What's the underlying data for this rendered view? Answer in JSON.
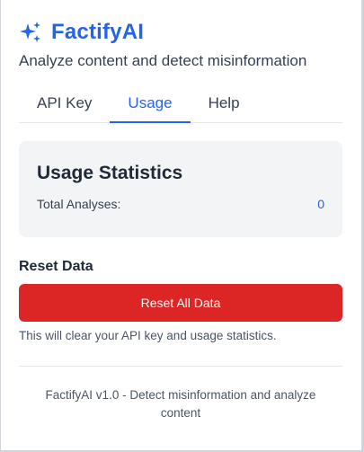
{
  "brand": {
    "title": "FactifyAI",
    "subtitle": "Analyze content and detect misinformation",
    "accent_color": "#2563eb",
    "icon": "sparkle-icon"
  },
  "tabs": [
    {
      "label": "API Key",
      "active": false
    },
    {
      "label": "Usage",
      "active": true
    },
    {
      "label": "Help",
      "active": false
    }
  ],
  "usage": {
    "title": "Usage Statistics",
    "total_label": "Total Analyses:",
    "total_value": "0"
  },
  "reset": {
    "title": "Reset Data",
    "button_label": "Reset All Data",
    "button_color": "#dc2626",
    "warning": "This will clear your API key and usage statistics."
  },
  "footer": {
    "text": "FactifyAI v1.0 - Detect misinformation and analyze content"
  }
}
